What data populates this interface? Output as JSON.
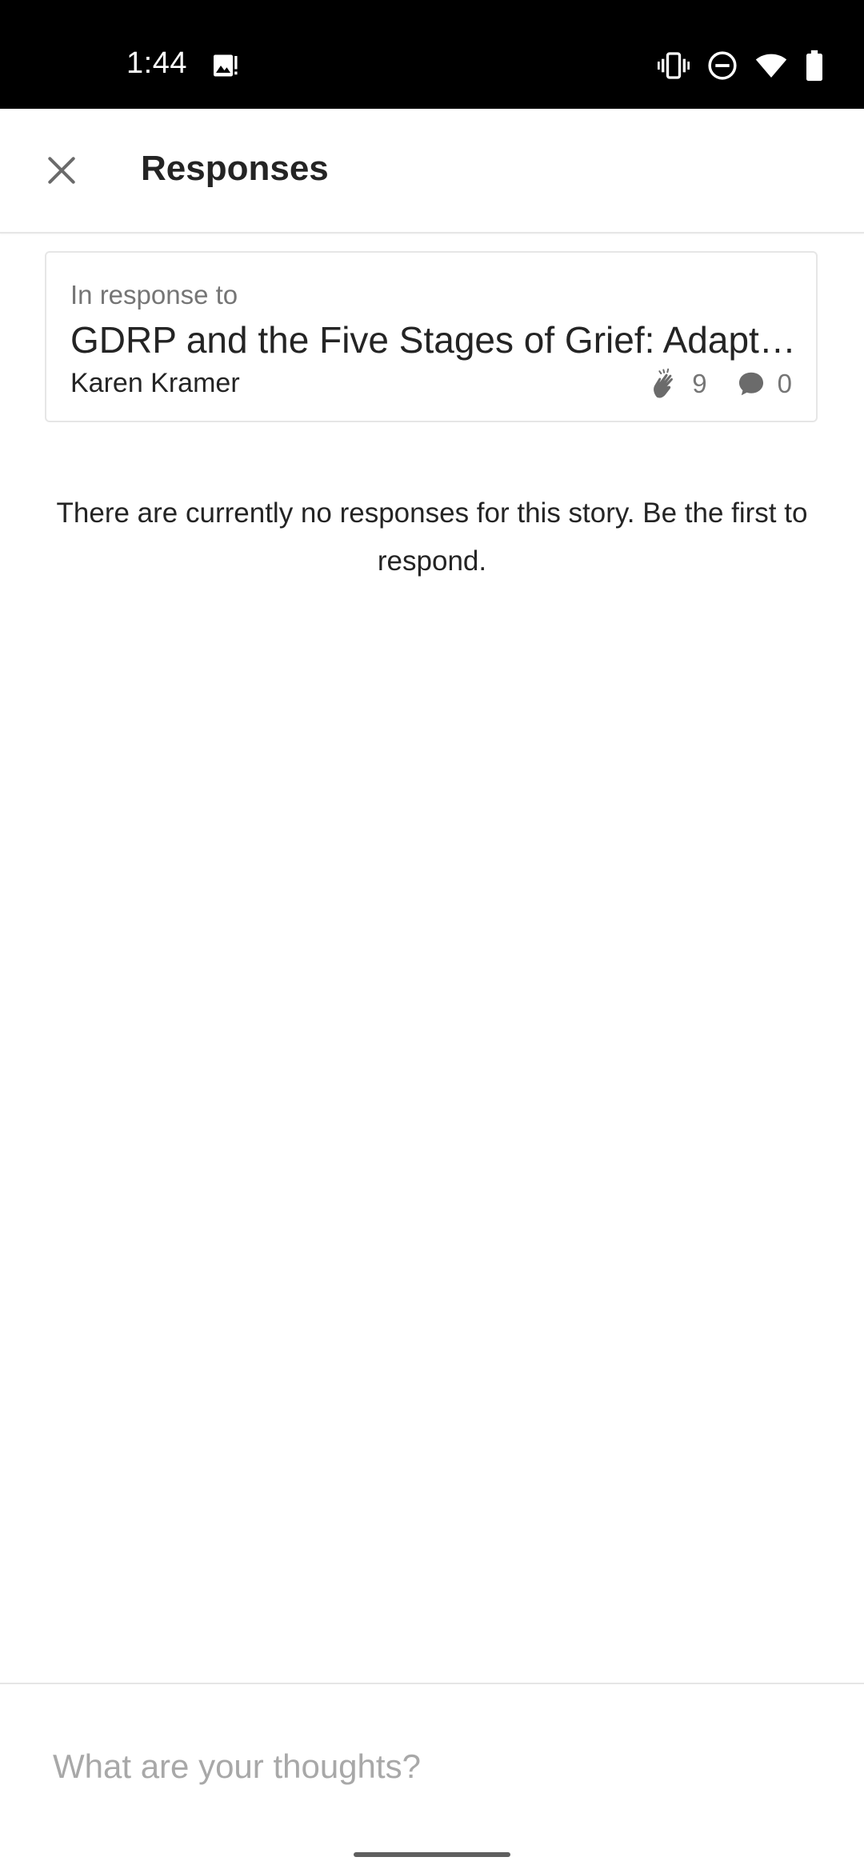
{
  "status_bar": {
    "time": "1:44",
    "icons": [
      "image-notification-icon",
      "vibrate-icon",
      "do-not-disturb-icon",
      "wifi-icon",
      "battery-icon"
    ]
  },
  "header": {
    "title": "Responses",
    "close_icon": "close-icon"
  },
  "story": {
    "label": "In response to",
    "title": "GDRP and the Five Stages of Grief: Adapti…",
    "author": "Karen Kramer",
    "claps": "9",
    "responses": "0",
    "clap_icon": "clap-icon",
    "comment_icon": "comment-icon"
  },
  "empty_state": {
    "message": "There are currently no responses for this story. Be the first to respond."
  },
  "composer": {
    "placeholder": "What are your thoughts?",
    "value": ""
  },
  "colors": {
    "status_bar_bg": "#000000",
    "text_primary": "#242424",
    "text_secondary": "#757575",
    "placeholder": "#a8a8a8",
    "divider": "#e6e6e6"
  }
}
